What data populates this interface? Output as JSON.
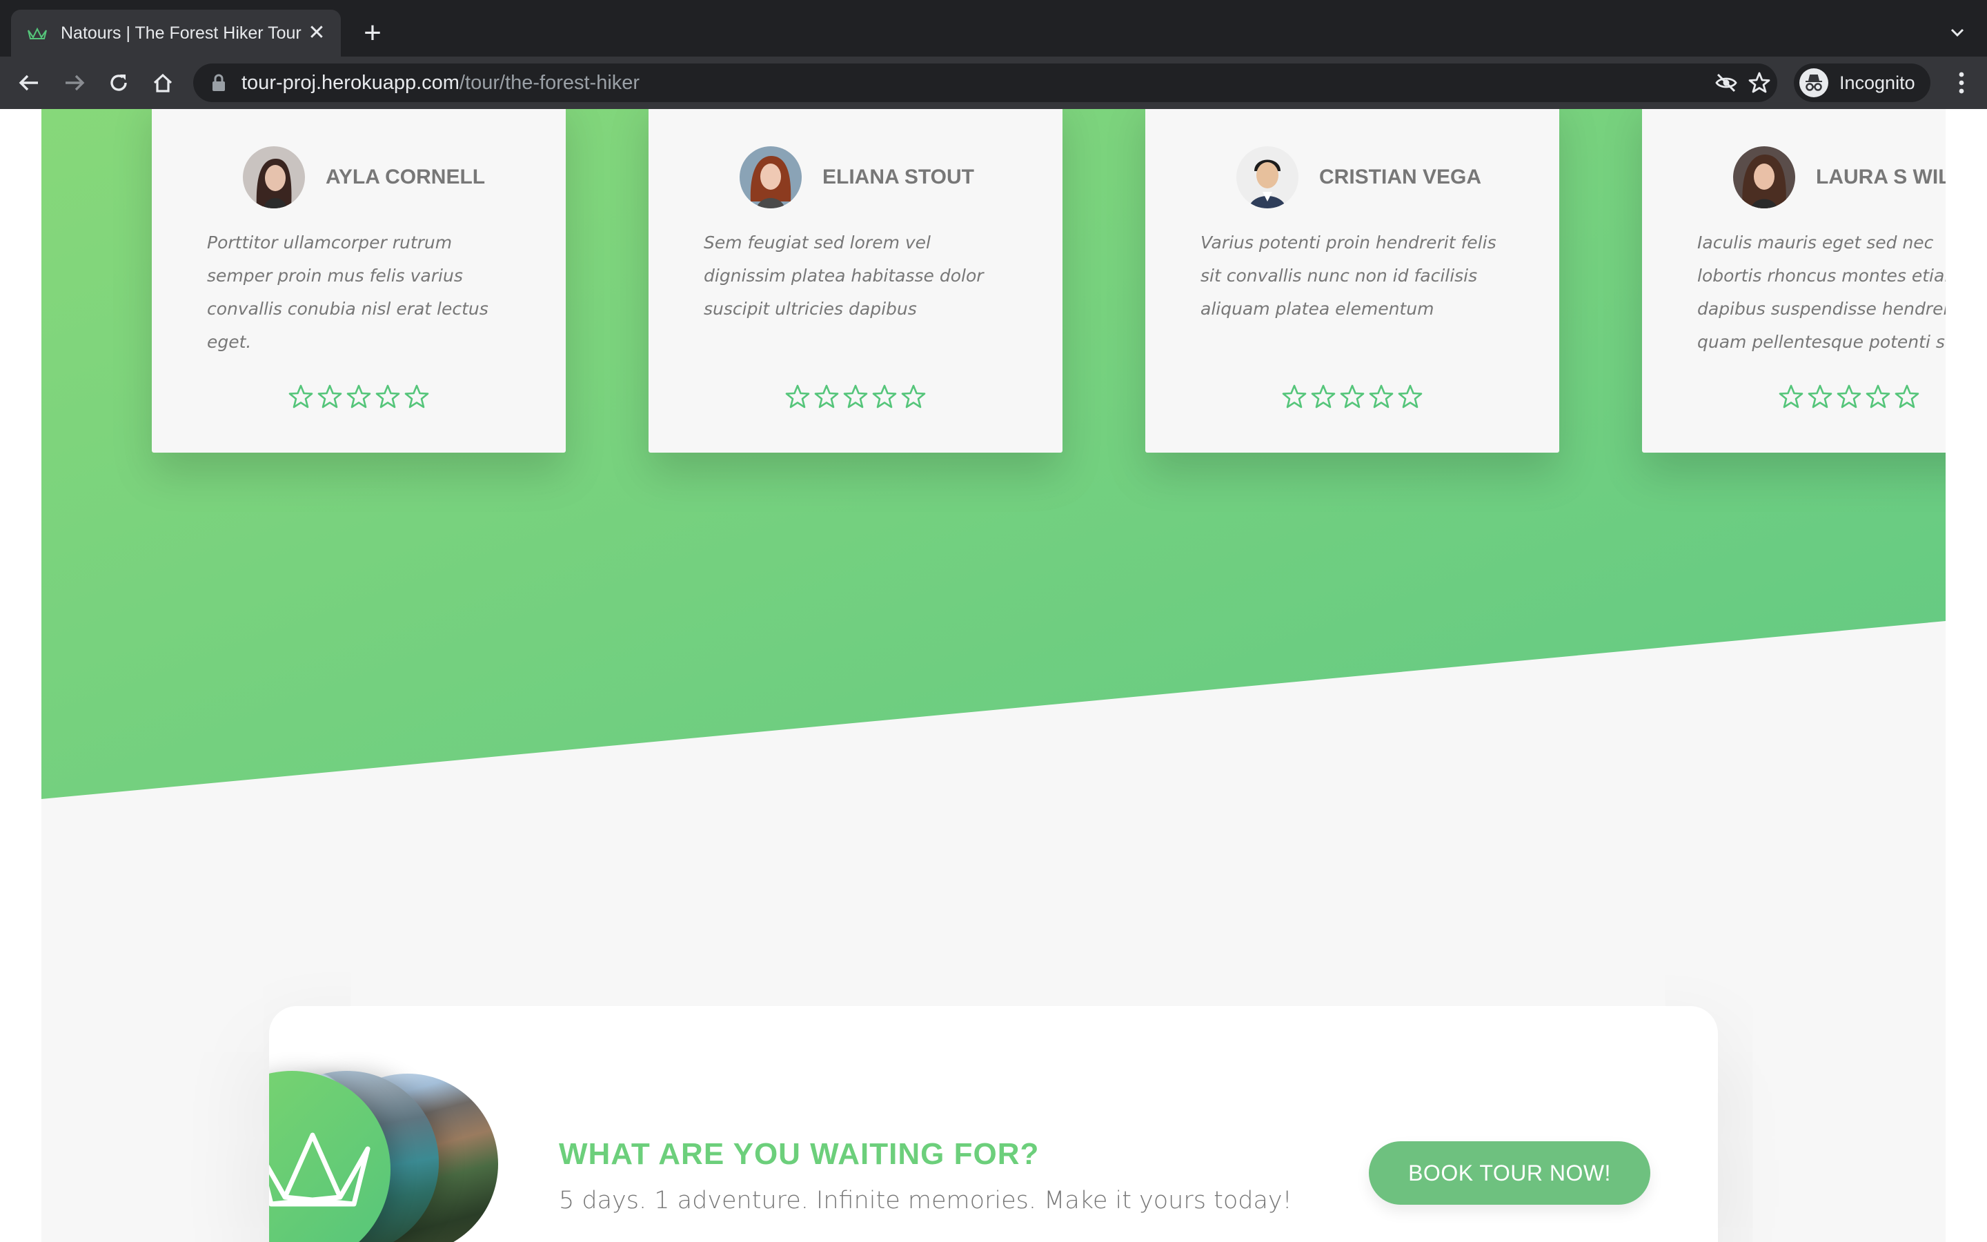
{
  "browser": {
    "tab_title": "Natours | The Forest Hiker Tour",
    "tab_close": "✕",
    "new_tab": "+",
    "url_host": "tour-proj.herokuapp.com",
    "url_path": "/tour/the-forest-hiker",
    "incognito_label": "Incognito"
  },
  "reviews": [
    {
      "name": "AYLA CORNELL",
      "text": "Porttitor ullamcorper rutrum semper proin mus felis varius convallis conubia nisl erat lectus eget.",
      "rating": 5
    },
    {
      "name": "ELIANA STOUT",
      "text": "Sem feugiat sed lorem vel dignissim platea habitasse dolor suscipit ultricies dapibus",
      "rating": 5
    },
    {
      "name": "CRISTIAN VEGA",
      "text": "Varius potenti proin hendrerit felis sit convallis nunc non id facilisis aliquam platea elementum",
      "rating": 5
    },
    {
      "name": "LAURA S WILSON",
      "text": "Iaculis mauris eget sed nec lobortis rhoncus montes etiam dapibus suspendisse hendrerit quam pellentesque potenti sapien!",
      "rating": 5
    }
  ],
  "cta": {
    "heading": "WHAT ARE YOU WAITING FOR?",
    "text": "5 days. 1 adventure. Infinite memories. Make it yours today!",
    "button_label": "BOOK TOUR NOW!"
  },
  "colors": {
    "primary_green": "#55c57a",
    "light_green": "#7dd56f",
    "heading_green": "#6ccf7b",
    "button_green": "#6ec17f"
  }
}
